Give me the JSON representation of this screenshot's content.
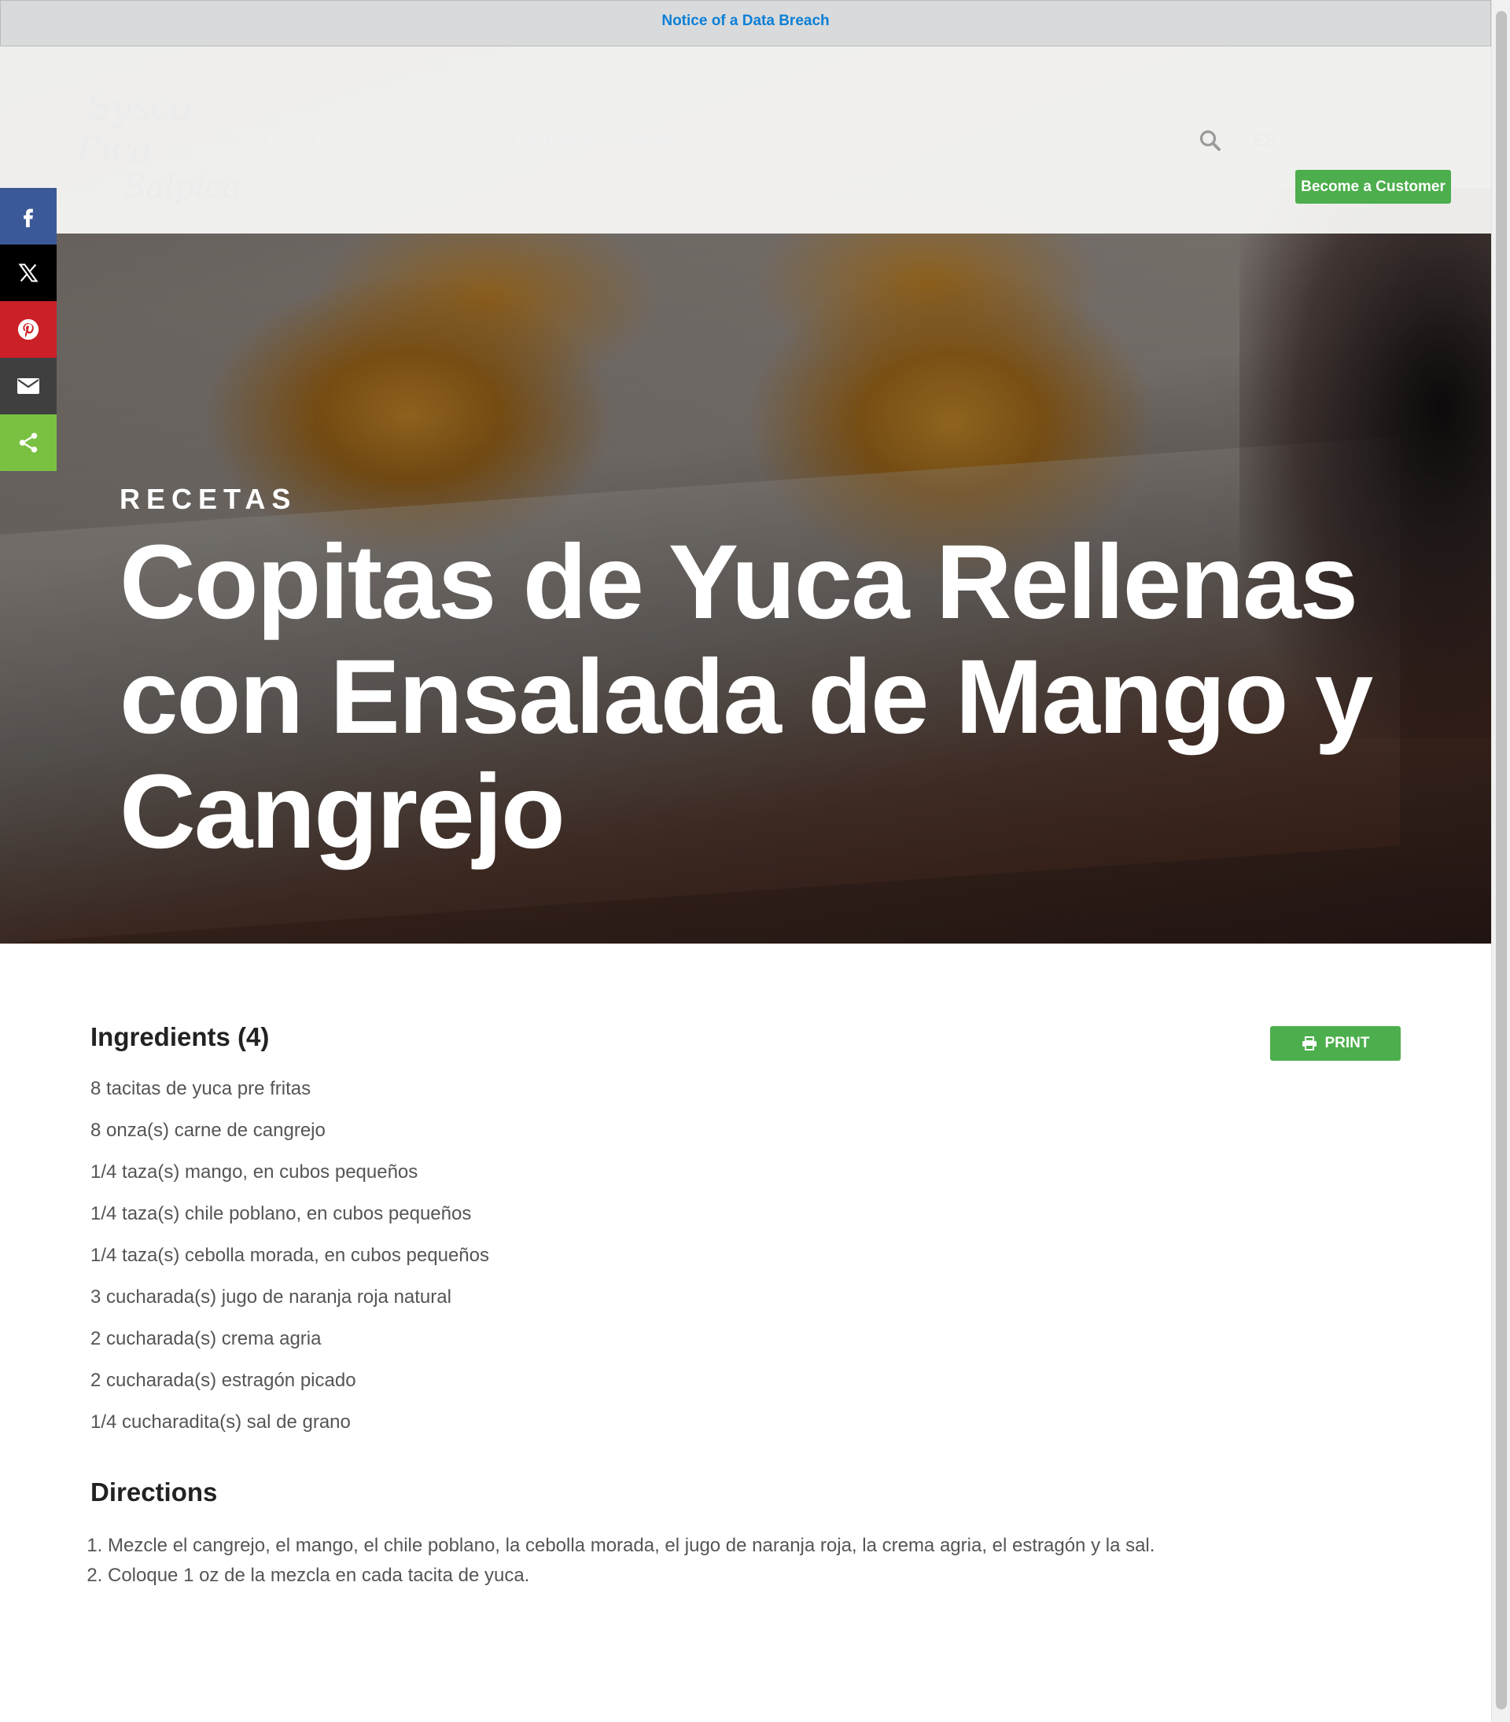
{
  "notice": {
    "text": "Notice of a Data Breach"
  },
  "header": {
    "logo": {
      "line1": "Sysco",
      "line2": "Pica",
      "line3": "Salpica"
    },
    "nav": [
      "Tips y Tendencias",
      "Recetas",
      "Productos",
      "Privacy"
    ],
    "lang": "ES",
    "cta": "Become a Customer"
  },
  "share": {
    "items": [
      {
        "name": "facebook",
        "icon": "facebook-icon",
        "color": "#3b5998"
      },
      {
        "name": "x",
        "icon": "x-icon",
        "color": "#000000"
      },
      {
        "name": "pinterest",
        "icon": "pinterest-icon",
        "color": "#cb2027"
      },
      {
        "name": "email",
        "icon": "mail-icon",
        "color": "#3f3f3f"
      },
      {
        "name": "share",
        "icon": "share-icon",
        "color": "#7ac142"
      }
    ]
  },
  "hero": {
    "eyebrow": "RECETAS",
    "title": "Copitas de Yuca Rellenas con Ensalada de Mango y Cangrejo"
  },
  "recipe": {
    "ingredients_title": "Ingredients (4)",
    "print_label": "PRINT",
    "ingredients": [
      "8 tacitas de yuca pre fritas",
      "8 onza(s) carne de cangrejo",
      "1/4 taza(s) mango, en cubos pequeños",
      "1/4 taza(s) chile poblano, en cubos pequeños",
      "1/4 taza(s) cebolla morada, en cubos pequeños",
      "3 cucharada(s) jugo de naranja roja natural",
      "2 cucharada(s) crema agria",
      "2 cucharada(s) estragón picado",
      "1/4 cucharadita(s) sal de grano"
    ],
    "directions_title": "Directions",
    "directions": [
      "Mezcle el cangrejo, el mango, el chile poblano, la cebolla morada, el jugo de naranja roja, la crema agria, el estragón y la sal.",
      "Coloque 1 oz de la mezcla en cada tacita de yuca."
    ]
  },
  "colors": {
    "accent_green": "#4cae4c",
    "notice_link": "#0c7fd6"
  }
}
